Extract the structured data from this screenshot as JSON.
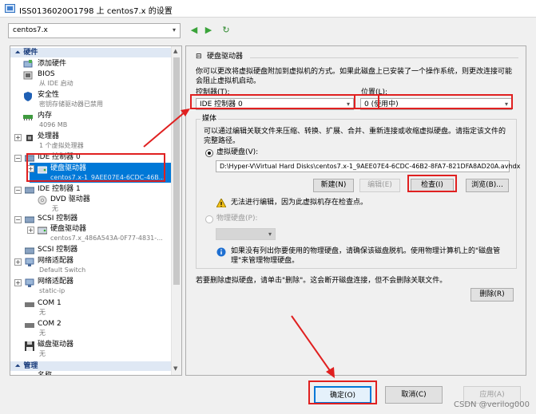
{
  "window": {
    "title": "ISS0136020O1798 上 centos7.x 的设置"
  },
  "toolbar": {
    "vm_name": "centos7.x"
  },
  "tree": {
    "section_hardware": "硬件",
    "add_hardware": "添加硬件",
    "bios": "BIOS",
    "bios_sub": "从 IDE 启动",
    "security": "安全性",
    "security_sub": "密钥存储驱动器已禁用",
    "memory": "内存",
    "memory_sub": "4096 MB",
    "processor": "处理器",
    "processor_sub": "1 个虚拟处理器",
    "ide0": "IDE 控制器 0",
    "ide0_disk": "硬盘驱动器",
    "ide0_disk_sub": "centos7.x-1_9AEE07E4-6CDC-46B...",
    "ide1": "IDE 控制器 1",
    "dvd": "DVD 驱动器",
    "dvd_sub": "无",
    "scsi1": "SCSI 控制器",
    "scsi1_disk": "硬盘驱动器",
    "scsi1_disk_sub": "centos7.x_486A543A-0F77-4831-...",
    "scsi2": "SCSI 控制器",
    "nic1": "网络适配器",
    "nic1_sub": "Default Switch",
    "nic2": "网络适配器",
    "nic2_sub": "static-ip",
    "com1": "COM 1",
    "com1_sub": "无",
    "com2": "COM 2",
    "com2_sub": "无",
    "floppy": "磁盘驱动器",
    "floppy_sub": "无",
    "section_manage": "管理",
    "name": "名称"
  },
  "panel": {
    "heading": "硬盘驱动器",
    "intro": "你可以更改将虚拟硬盘附加到虚拟机的方式。如果此磁盘上已安装了一个操作系统，则更改连接可能会阻止虚拟机启动。",
    "controller_label": "控制器(T):",
    "controller_value": "IDE 控制器 0",
    "location_label": "位置(L):",
    "location_value": "0 (使用中)",
    "media_label": "媒体",
    "media_desc": "可以通过编辑关联文件来压缩、转换、扩展、合并、重新连接或收缩虚拟硬盘。请指定该文件的完整路径。",
    "vhd_label": "虚拟硬盘(V):",
    "vhd_path": "D:\\Hyper-V\\Virtual Hard Disks\\centos7.x-1_9AEE07E4-6CDC-46B2-8FA7-821DFA8AD20A.avhdx",
    "new_btn": "新建(N)",
    "edit_btn": "编辑(E)",
    "inspect_btn": "检查(I)",
    "browse_btn": "浏览(B)...",
    "warn_text": "无法进行编辑，因为此虚拟机存在检查点。",
    "physical_label": "物理硬盘(P):",
    "info_text": "如果没有列出你要使用的物理硬盘，请确保该磁盘脱机。使用物理计算机上的\"磁盘管理\"来管理物理硬盘。",
    "remove_text": "若要删除虚拟硬盘，请单击\"删除\"。这会断开磁盘连接，但不会删除关联文件。",
    "remove_btn": "删除(R)"
  },
  "footer": {
    "ok": "确定(O)",
    "cancel": "取消(C)",
    "apply": "应用(A)"
  },
  "watermark": "CSDN @verilog000",
  "colors": {
    "annotation": "#e02020",
    "selection": "#0078d7",
    "section_bg": "#dfe8f4"
  }
}
